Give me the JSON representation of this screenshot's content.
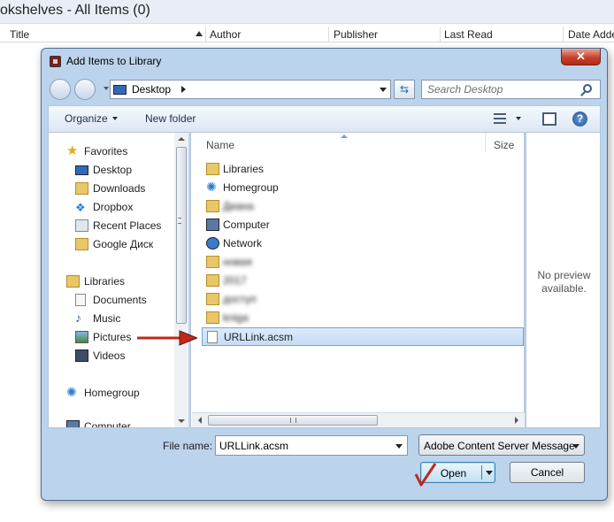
{
  "background": {
    "title": "okshelves - All Items (0)",
    "columns": [
      "Title",
      "Author",
      "Publisher",
      "Last Read",
      "Date Adde"
    ]
  },
  "dialog": {
    "title": "Add Items to Library",
    "close_label": "✕",
    "address": {
      "location": "Desktop"
    },
    "search": {
      "placeholder": "Search Desktop"
    },
    "toolbar": {
      "organize": "Organize",
      "new_folder": "New folder",
      "help": "?"
    },
    "nav": {
      "favorites": {
        "label": "Favorites",
        "items": [
          "Desktop",
          "Downloads",
          "Dropbox",
          "Recent Places",
          "Google Диск"
        ]
      },
      "libraries": {
        "label": "Libraries",
        "items": [
          "Documents",
          "Music",
          "Pictures",
          "Videos"
        ]
      },
      "homegroup": "Homegroup",
      "computer": "Computer"
    },
    "files": {
      "columns": {
        "name": "Name",
        "size": "Size"
      },
      "rows": [
        {
          "name": "Libraries",
          "icon": "libraries-icon"
        },
        {
          "name": "Homegroup",
          "icon": "homegroup-icon"
        },
        {
          "name": "Диана",
          "icon": "user-folder-icon",
          "blurred": true
        },
        {
          "name": "Computer",
          "icon": "computer-icon"
        },
        {
          "name": "Network",
          "icon": "network-icon"
        },
        {
          "name": "новая",
          "icon": "folder-icon",
          "blurred": true
        },
        {
          "name": "2017",
          "icon": "folder-icon",
          "blurred": true
        },
        {
          "name": "доступ",
          "icon": "folder-icon",
          "blurred": true
        },
        {
          "name": "kniga",
          "icon": "folder-icon",
          "blurred": true
        },
        {
          "name": "URLLink.acsm",
          "icon": "file-icon",
          "selected": true
        }
      ]
    },
    "preview": {
      "text": "No preview available."
    },
    "filename": {
      "label": "File name:",
      "value": "URLLink.acsm"
    },
    "filetype": {
      "value": "Adobe Content Server Message"
    },
    "buttons": {
      "open": "Open",
      "cancel": "Cancel"
    }
  },
  "colors": {
    "dialog_frame": "#bcd3ec",
    "selection": "#c4dcf7",
    "annotation": "#c0281c"
  }
}
